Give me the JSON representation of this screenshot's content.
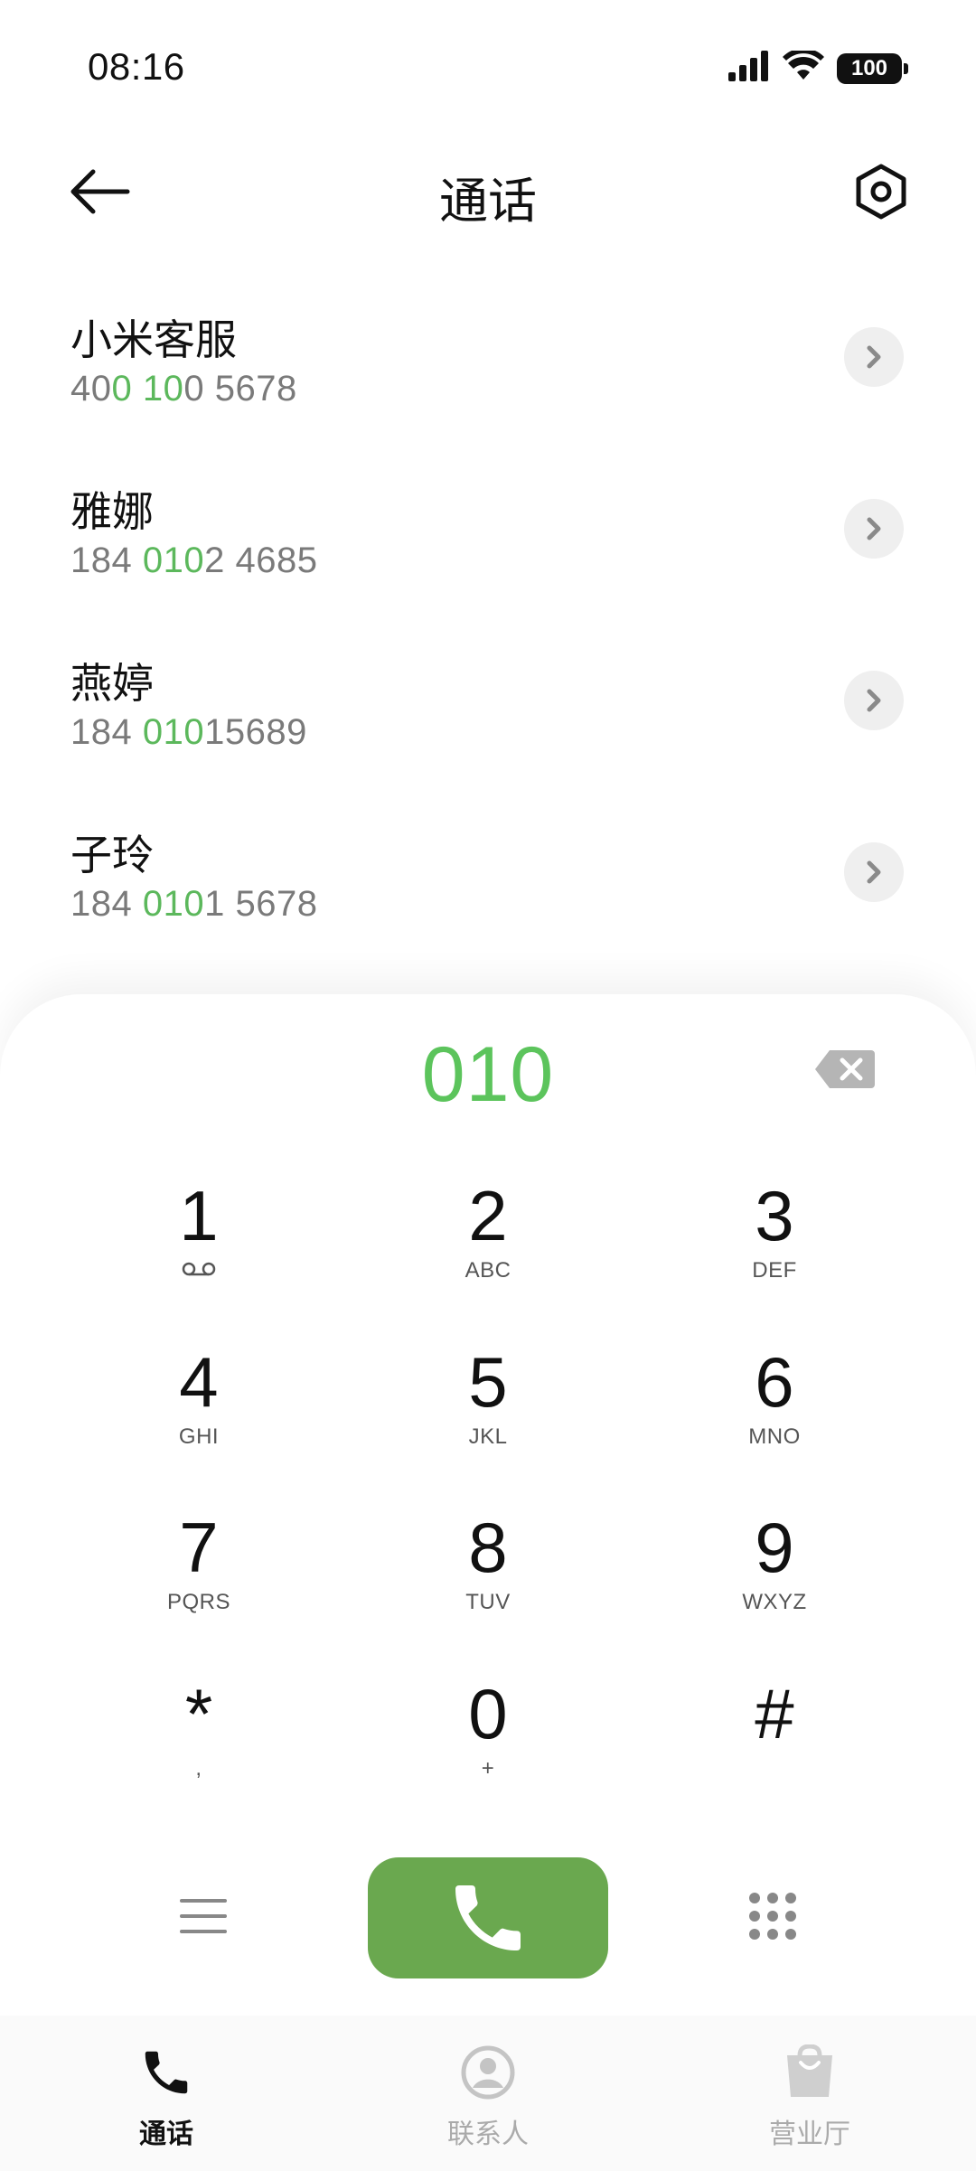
{
  "status_bar": {
    "time": "08:16",
    "battery": "100",
    "icons": [
      "signal-icon",
      "wifi-icon",
      "battery-icon"
    ]
  },
  "header": {
    "title": "通话",
    "back_icon": "back-arrow-icon",
    "settings_icon": "settings-hexagon-icon"
  },
  "matches": [
    {
      "name": "小米客服",
      "number_parts": [
        [
          "40",
          false
        ],
        [
          "0",
          true
        ],
        [
          " ",
          false
        ],
        [
          "10",
          true
        ],
        [
          "0 5678",
          false
        ]
      ]
    },
    {
      "name": "雅娜",
      "number_parts": [
        [
          "184 ",
          false
        ],
        [
          "010",
          true
        ],
        [
          "2 4685",
          false
        ]
      ]
    },
    {
      "name": "燕婷",
      "number_parts": [
        [
          "184 ",
          false
        ],
        [
          "010",
          true
        ],
        [
          "15689",
          false
        ]
      ]
    },
    {
      "name": "子玲",
      "number_parts": [
        [
          "184 ",
          false
        ],
        [
          "010",
          true
        ],
        [
          "1 5678",
          false
        ]
      ]
    }
  ],
  "dialpad": {
    "entered": "010",
    "keys": [
      {
        "digit": "1",
        "letters": "voicemail"
      },
      {
        "digit": "2",
        "letters": "ABC"
      },
      {
        "digit": "3",
        "letters": "DEF"
      },
      {
        "digit": "4",
        "letters": "GHI"
      },
      {
        "digit": "5",
        "letters": "JKL"
      },
      {
        "digit": "6",
        "letters": "MNO"
      },
      {
        "digit": "7",
        "letters": "PQRS"
      },
      {
        "digit": "8",
        "letters": "TUV"
      },
      {
        "digit": "9",
        "letters": "WXYZ"
      },
      {
        "digit": "*",
        "letters": ","
      },
      {
        "digit": "0",
        "letters": "+"
      },
      {
        "digit": "#",
        "letters": ""
      }
    ]
  },
  "colors": {
    "highlight": "#5cb85c",
    "call_button": "#6aa84f"
  },
  "bottom_nav": [
    {
      "label": "通话",
      "icon": "phone-icon",
      "active": true
    },
    {
      "label": "联系人",
      "icon": "contacts-icon",
      "active": false
    },
    {
      "label": "营业厅",
      "icon": "store-bag-icon",
      "active": false
    }
  ]
}
